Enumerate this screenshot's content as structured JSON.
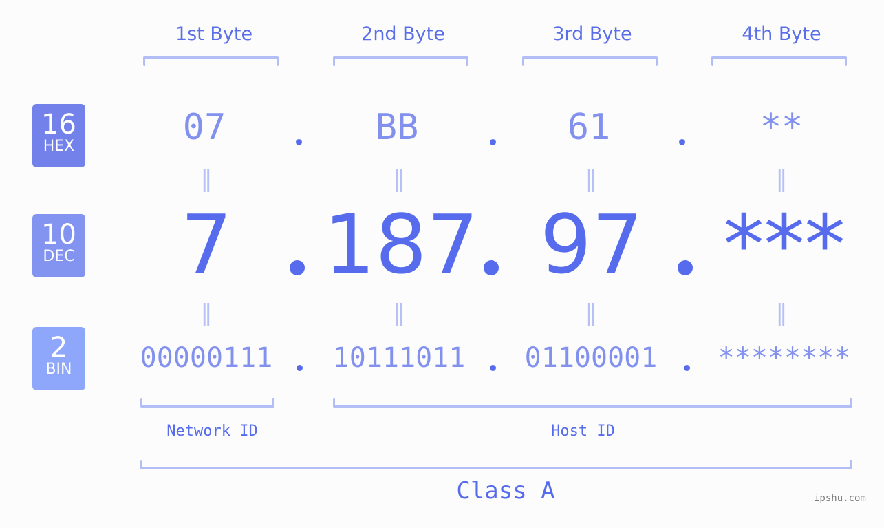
{
  "headers": [
    "1st Byte",
    "2nd Byte",
    "3rd Byte",
    "4th Byte"
  ],
  "badges": {
    "hex": {
      "num": "16",
      "label": "HEX",
      "color": "#7381ea"
    },
    "dec": {
      "num": "10",
      "label": "DEC",
      "color": "#8393f0"
    },
    "bin": {
      "num": "2",
      "label": "BIN",
      "color": "#8fa7fa"
    }
  },
  "hex": [
    "07",
    "BB",
    "61",
    "**"
  ],
  "dec": [
    "7",
    "187",
    "97",
    "***"
  ],
  "bin": [
    "00000111",
    "10111011",
    "01100001",
    "********"
  ],
  "equals": "=",
  "network_label": "Network ID",
  "host_label": "Host ID",
  "class_label": "Class A",
  "watermark": "ipshu.com"
}
